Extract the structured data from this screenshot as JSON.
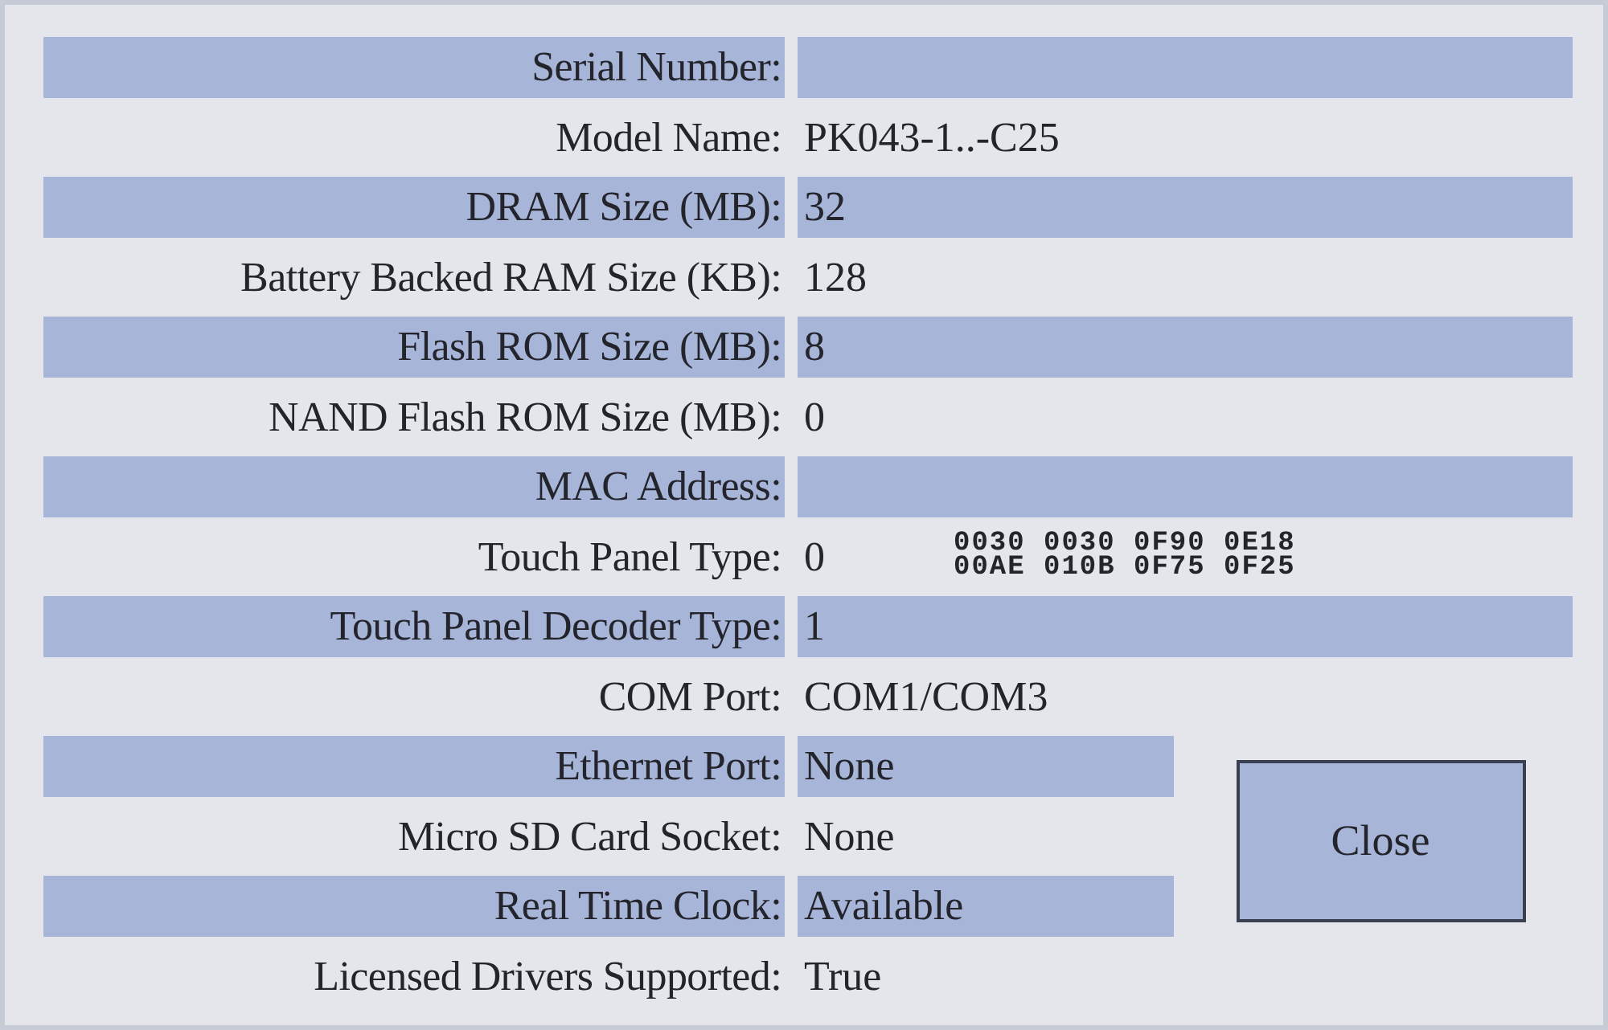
{
  "rows": [
    {
      "label": "Serial Number:",
      "shaded": true
    },
    {
      "label": "Model Name:",
      "value": "PK043-1..-C25",
      "shaded": false
    },
    {
      "label": "DRAM Size (MB):",
      "value": "32",
      "shaded": true
    },
    {
      "label": "Battery Backed RAM Size (KB):",
      "value": "128",
      "shaded": false
    },
    {
      "label": "Flash ROM Size (MB):",
      "value": "8",
      "shaded": true
    },
    {
      "label": "NAND Flash ROM Size (MB):",
      "value": "0",
      "shaded": false
    },
    {
      "label": "MAC Address:",
      "shaded": true
    },
    {
      "label": "Touch Panel Type:",
      "value": "0",
      "shaded": false,
      "calibration": [
        "0030 0030 0F90 0E18",
        "00AE 010B 0F75 0F25"
      ]
    },
    {
      "label": "Touch Panel Decoder Type:",
      "value": "1",
      "shaded": true
    },
    {
      "label": "COM Port:",
      "value": "COM1/COM3",
      "shaded": false
    }
  ],
  "lower_rows": [
    {
      "label": "Ethernet Port:",
      "value": "None",
      "shaded": true
    },
    {
      "label": "Micro SD Card Socket:",
      "value": "None",
      "shaded": false
    },
    {
      "label": "Real Time Clock:",
      "value": "Available",
      "shaded": true
    },
    {
      "label": "Licensed Drivers Supported:",
      "value": "True",
      "shaded": false
    }
  ],
  "close_button": "Close"
}
